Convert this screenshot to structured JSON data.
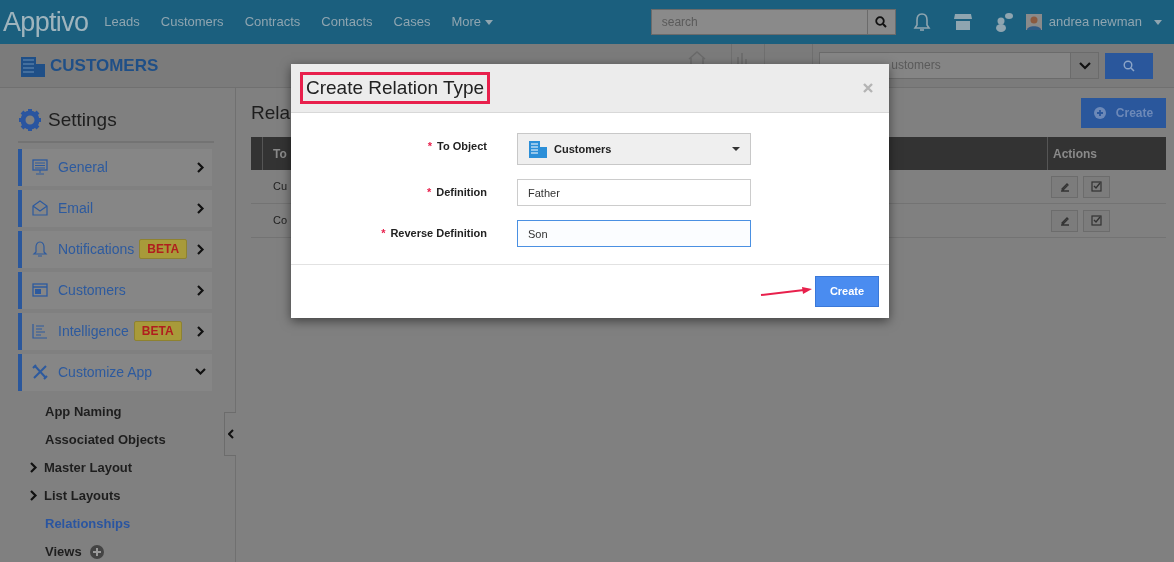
{
  "top_bar": {
    "logo": "Apptivo",
    "nav": [
      "Leads",
      "Customers",
      "Contracts",
      "Contacts",
      "Cases",
      "More"
    ],
    "search": {
      "placeholder": "search"
    },
    "user": "andrea newman"
  },
  "app_bar": {
    "title": "CUSTOMERS",
    "search": {
      "placeholder": "ustomers"
    }
  },
  "sidebar": {
    "title": "Settings",
    "items": [
      {
        "label": "General",
        "expanded": false
      },
      {
        "label": "Email",
        "expanded": false
      },
      {
        "label": "Notifications",
        "badge": "BETA",
        "expanded": false
      },
      {
        "label": "Customers",
        "expanded": false
      },
      {
        "label": "Intelligence",
        "badge": "BETA",
        "expanded": false
      },
      {
        "label": "Customize App",
        "expanded": true
      }
    ],
    "sub_items": [
      {
        "label": "App Naming",
        "kind": "plain",
        "selected": false
      },
      {
        "label": "Associated Objects",
        "kind": "plain",
        "selected": false
      },
      {
        "label": "Master Layout",
        "kind": "folder",
        "selected": false
      },
      {
        "label": "List Layouts",
        "kind": "folder",
        "selected": false
      },
      {
        "label": "Relationships",
        "kind": "plain",
        "selected": true
      },
      {
        "label": "Views",
        "kind": "add",
        "selected": false
      }
    ]
  },
  "main": {
    "title": "Rela",
    "create_button": "Create",
    "table": {
      "columns": [
        "To",
        "Actions"
      ],
      "rows": [
        [
          "Cu"
        ],
        [
          "Co"
        ]
      ]
    }
  },
  "dialog": {
    "title": "Create Relation Type",
    "fields": [
      {
        "label": "To Object",
        "kind": "select",
        "value": "Customers",
        "required_mark": "*",
        "focused": false
      },
      {
        "label": "Definition",
        "kind": "text",
        "value": "Father",
        "required_mark": "*",
        "focused": false
      },
      {
        "label": "Reverse Definition",
        "kind": "text",
        "value": "Son",
        "required_mark": "*",
        "focused": true
      }
    ],
    "button": "Create"
  }
}
